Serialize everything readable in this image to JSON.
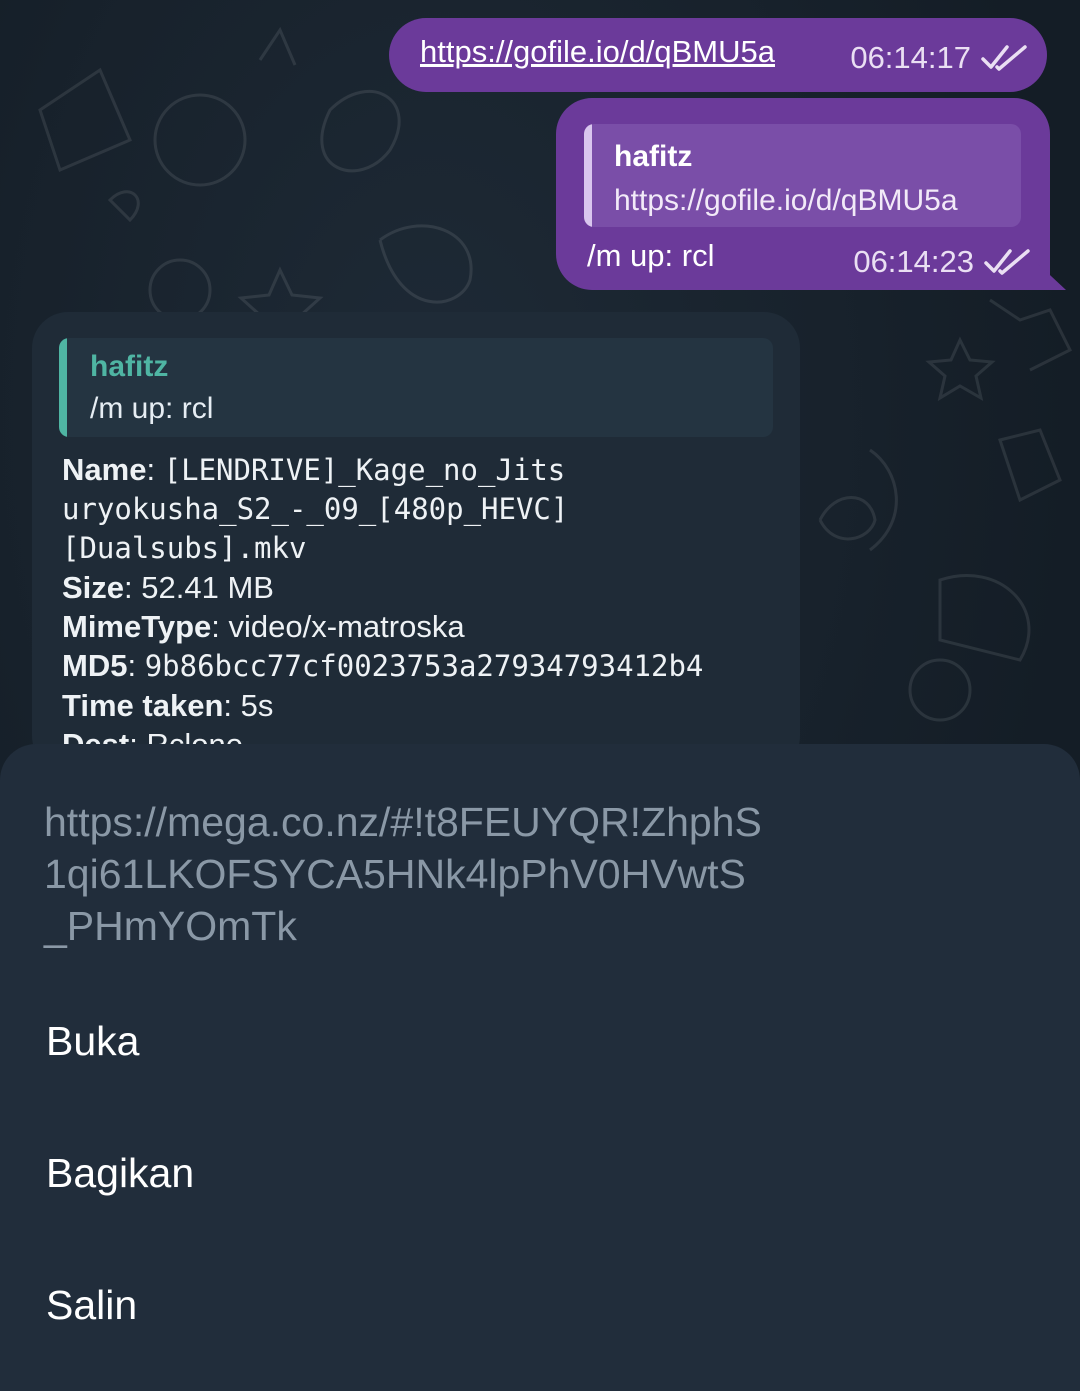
{
  "colors": {
    "background": "#17212b",
    "outgoing_bubble": "#6b3a9a",
    "incoming_bubble": "#1f2b37",
    "reply_accent_incoming": "#4fb5a3",
    "sheet_background": "#212d3b"
  },
  "messages": {
    "out1": {
      "link": "https://gofile.io/d/qBMU5a",
      "time": "06:14:17",
      "status_icon": "double-check-icon"
    },
    "out2": {
      "reply_name": "hafitz",
      "reply_text": "https://gofile.io/d/qBMU5a",
      "text": "/m up: rcl",
      "time": "06:14:23",
      "status_icon": "double-check-icon"
    },
    "in1": {
      "reply_name": "hafitz",
      "reply_text": "/m up: rcl",
      "name_label": "Name",
      "name_line1": "[LENDRIVE]_Kage_no_Jits",
      "name_line2": "uryokusha_S2_-_09_[480p_HEVC]",
      "name_line3": "[Dualsubs].mkv",
      "size_label": "Size",
      "size_value": "52.41 MB",
      "mime_label": "MimeType",
      "mime_value": "video/x-matroska",
      "md5_label": "MD5",
      "md5_value": "9b86bcc77cf0023753a27934793412b4",
      "time_label": "Time taken",
      "time_value": "5s",
      "dest_label": "Dest",
      "dest_value": "Rclone"
    }
  },
  "sheet": {
    "url_line1": "https://mega.co.nz/#!t8FEUYQR!ZhphS",
    "url_line2": "1qi61LKOFSYCA5HNk4lpPhV0HVwtS",
    "url_line3": "_PHmYOmTk",
    "actions": {
      "open": "Buka",
      "share": "Bagikan",
      "copy": "Salin"
    }
  }
}
